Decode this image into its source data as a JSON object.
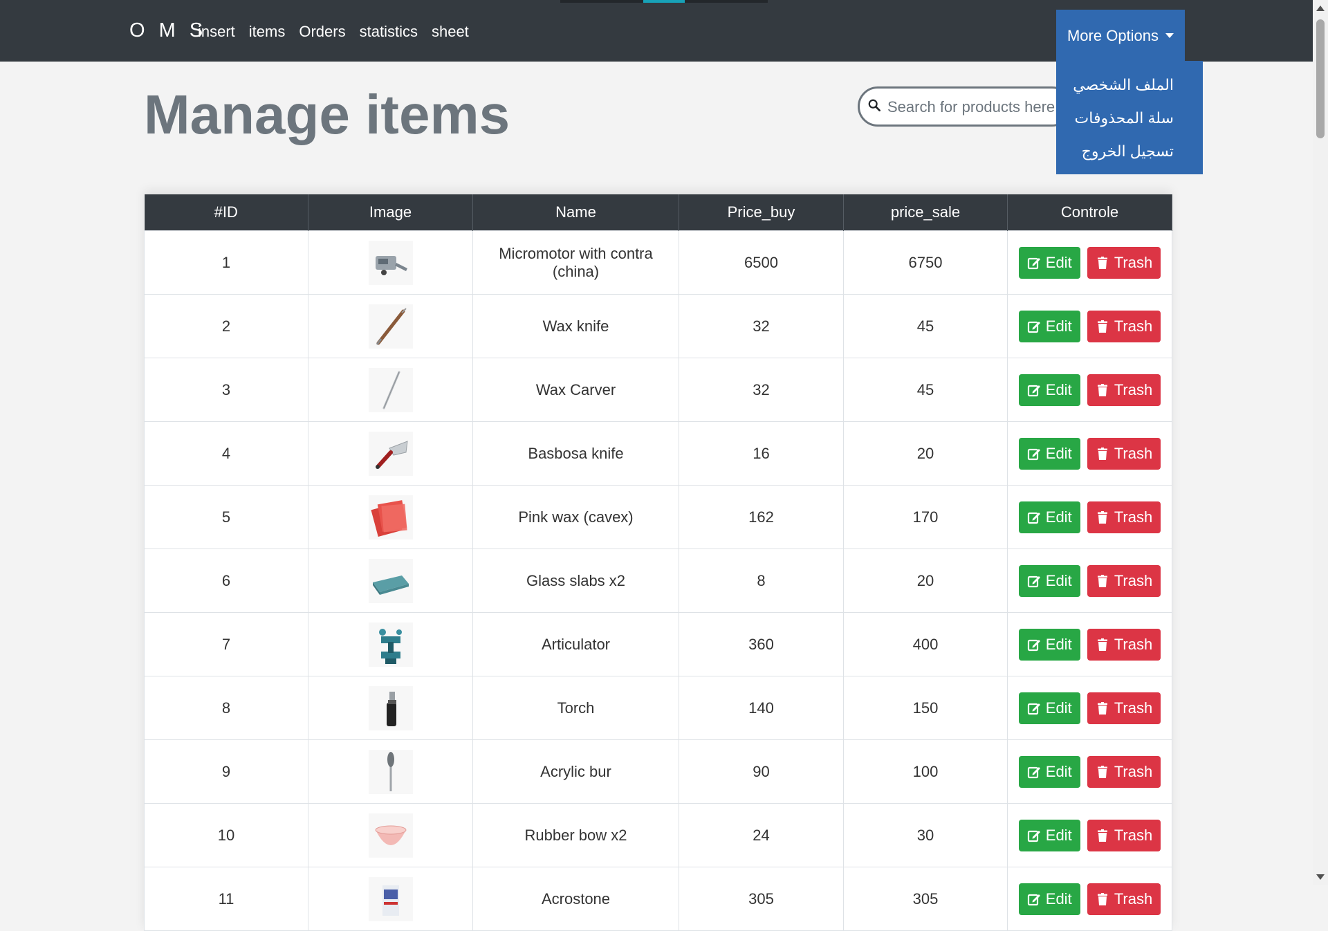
{
  "nav": {
    "brand": "O M S",
    "links": [
      "insert",
      "items",
      "Orders",
      "statistics",
      "sheet"
    ],
    "more_options": "More Options",
    "accent_color": "#17a2b8"
  },
  "dropdown": {
    "items": [
      "الملف الشخصي",
      "سلة المحذوفات",
      "تسجيل الخروج"
    ]
  },
  "page": {
    "title": "Manage items"
  },
  "search": {
    "placeholder": "Search for products here"
  },
  "table": {
    "headers": [
      "#ID",
      "Image",
      "Name",
      "Price_buy",
      "price_sale",
      "Controle"
    ],
    "edit_label": "Edit",
    "trash_label": "Trash",
    "rows": [
      {
        "id": "1",
        "name": "Micromotor with contra (china)",
        "price_buy": "6500",
        "price_sale": "6750",
        "image": "micromotor"
      },
      {
        "id": "2",
        "name": "Wax knife",
        "price_buy": "32",
        "price_sale": "45",
        "image": "wax-knife"
      },
      {
        "id": "3",
        "name": "Wax Carver",
        "price_buy": "32",
        "price_sale": "45",
        "image": "wax-carver"
      },
      {
        "id": "4",
        "name": "Basbosa knife",
        "price_buy": "16",
        "price_sale": "20",
        "image": "spatula"
      },
      {
        "id": "5",
        "name": "Pink wax (cavex)",
        "price_buy": "162",
        "price_sale": "170",
        "image": "pink-wax"
      },
      {
        "id": "6",
        "name": "Glass slabs x2",
        "price_buy": "8",
        "price_sale": "20",
        "image": "glass-slab"
      },
      {
        "id": "7",
        "name": "Articulator",
        "price_buy": "360",
        "price_sale": "400",
        "image": "articulator"
      },
      {
        "id": "8",
        "name": "Torch",
        "price_buy": "140",
        "price_sale": "150",
        "image": "torch"
      },
      {
        "id": "9",
        "name": "Acrylic bur",
        "price_buy": "90",
        "price_sale": "100",
        "image": "bur"
      },
      {
        "id": "10",
        "name": "Rubber bow x2",
        "price_buy": "24",
        "price_sale": "30",
        "image": "rubber-bowl"
      },
      {
        "id": "11",
        "name": "Acrostone",
        "price_buy": "305",
        "price_sale": "305",
        "image": "acrostone"
      }
    ]
  },
  "colors": {
    "navbar": "#343a40",
    "dropdown": "#3069b0",
    "edit": "#28a745",
    "trash": "#dc3545",
    "title": "#6c757d"
  }
}
